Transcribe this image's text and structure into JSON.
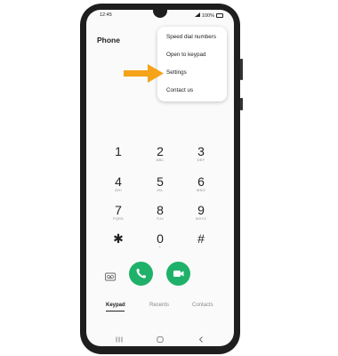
{
  "status_bar": {
    "time": "12:45",
    "battery": "100%"
  },
  "header": {
    "title": "Phone"
  },
  "menu": {
    "items": [
      {
        "label": "Speed dial numbers"
      },
      {
        "label": "Open to keypad"
      },
      {
        "label": "Settings"
      },
      {
        "label": "Contact us"
      }
    ]
  },
  "keypad": {
    "keys": [
      {
        "digit": "1",
        "letters": ""
      },
      {
        "digit": "2",
        "letters": "ABC"
      },
      {
        "digit": "3",
        "letters": "DEF"
      },
      {
        "digit": "4",
        "letters": "GHI"
      },
      {
        "digit": "5",
        "letters": "JKL"
      },
      {
        "digit": "6",
        "letters": "MNO"
      },
      {
        "digit": "7",
        "letters": "PQRS"
      },
      {
        "digit": "8",
        "letters": "TUV"
      },
      {
        "digit": "9",
        "letters": "WXYZ"
      },
      {
        "digit": "✱",
        "letters": ""
      },
      {
        "digit": "0",
        "letters": "+"
      },
      {
        "digit": "#",
        "letters": ""
      }
    ]
  },
  "tabs": [
    {
      "label": "Keypad"
    },
    {
      "label": "Recents"
    },
    {
      "label": "Contacts"
    }
  ],
  "colors": {
    "accent_green": "#1fb16a",
    "highlight_arrow": "#f5a31a"
  },
  "icons": [
    "voicemail-icon",
    "call-icon",
    "video-call-icon",
    "recents-nav-icon",
    "home-nav-icon",
    "back-nav-icon"
  ]
}
